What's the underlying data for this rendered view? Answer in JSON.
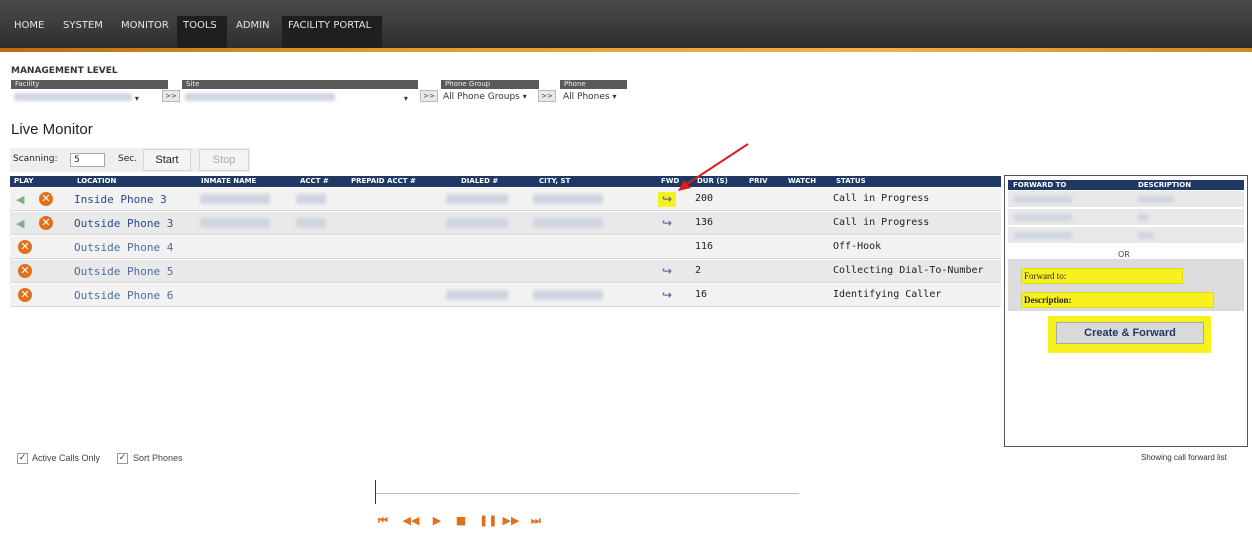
{
  "nav": {
    "items": [
      "HOME",
      "SYSTEM",
      "MONITOR",
      "TOOLS",
      "ADMIN",
      "FACILITY PORTAL"
    ]
  },
  "management": {
    "title": "MANAGEMENT LEVEL",
    "facility_label": "Facility",
    "site_label": "Site",
    "phone_group_label": "Phone Group",
    "phone_label": "Phone",
    "phone_group_value": "All Phone Groups",
    "phone_value": "All Phones",
    "go_label": ">>"
  },
  "live_monitor": {
    "title": "Live Monitor",
    "scanning_label": "Scanning:",
    "scanning_value": "5",
    "sec_label": "Sec.",
    "start_label": "Start",
    "stop_label": "Stop"
  },
  "table": {
    "headers": [
      "PLAY",
      "LOCATION",
      "INMATE NAME",
      "ACCT #",
      "PREPAID ACCT #",
      "DIALED #",
      "CITY, ST",
      "FWD",
      "DUR (S)",
      "PRIV",
      "WATCH",
      "STATUS"
    ],
    "rows": [
      {
        "location": "Inside Phone 3",
        "duration": "200",
        "status": "Call in Progress"
      },
      {
        "location": "Outside Phone 3",
        "duration": "136",
        "status": "Call in Progress"
      },
      {
        "location": "Outside Phone 4",
        "duration": "116",
        "status": "Off-Hook"
      },
      {
        "location": "Outside Phone 5",
        "duration": "2",
        "status": "Collecting Dial-To-Number"
      },
      {
        "location": "Outside Phone 6",
        "duration": "16",
        "status": "Identifying Caller"
      }
    ]
  },
  "forward_panel": {
    "col_forward_to": "FORWARD TO",
    "col_description": "DESCRIPTION",
    "or_label": "OR",
    "forward_to_label": "Forward to:",
    "description_label": "Description:",
    "create_button": "Create & Forward"
  },
  "footer": {
    "active_calls_only": "Active Calls Only",
    "sort_phones": "Sort Phones",
    "showing_label": "Showing call forward list"
  },
  "colors": {
    "nav_bg": "#3a3a3a",
    "header_blue": "#1f3864",
    "highlight_yellow": "#f8f11d",
    "orange_accent": "#e0701c"
  }
}
